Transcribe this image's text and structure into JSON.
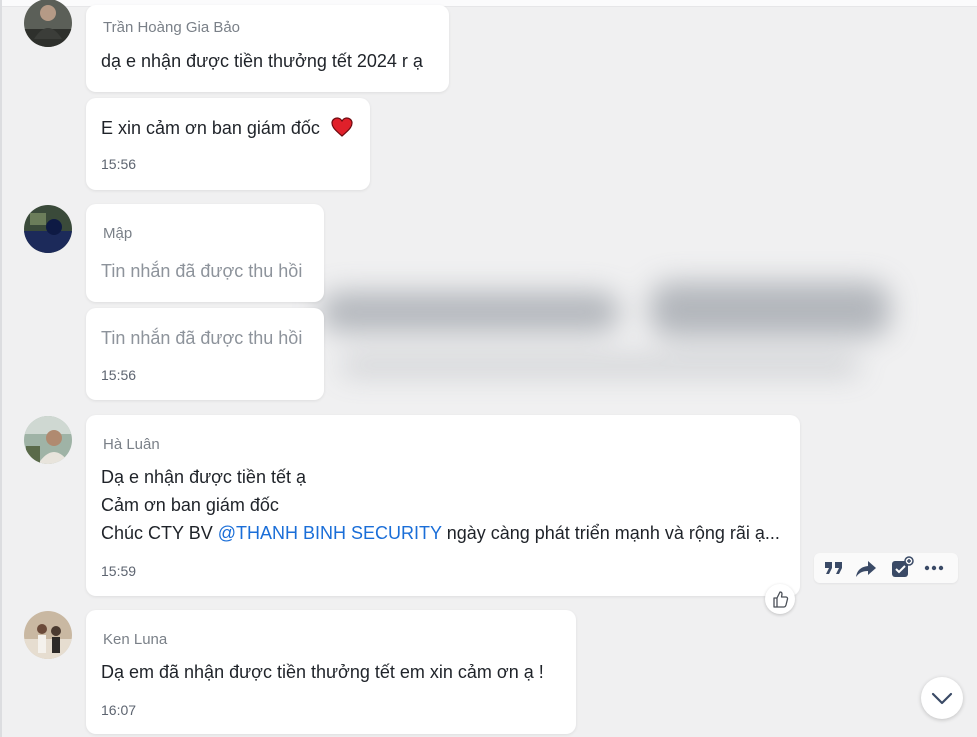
{
  "messages": [
    {
      "sender": "Trần Hoàng Gia Bảo",
      "bubbles": [
        {
          "lines": [
            "dạ e nhận được tiền thưởng tết 2024 r ạ"
          ]
        },
        {
          "lines": [
            "E xin cảm ơn ban giám đốc"
          ],
          "emoji": "red-heart",
          "time": "15:56"
        }
      ]
    },
    {
      "sender": "Mập",
      "bubbles": [
        {
          "lines": [
            "Tin nhắn đã được thu hồi"
          ]
        },
        {
          "lines": [
            "Tin nhắn đã được thu hồi"
          ],
          "time": "15:56"
        }
      ]
    },
    {
      "sender": "Hà Luân",
      "bubbles": [
        {
          "lines": [
            "Dạ e nhận được tiền tết ạ",
            "Cảm ơn ban giám đốc"
          ],
          "line3_prefix": "Chúc CTY BV ",
          "line3_mention": "@THANH BINH SECURITY",
          "line3_suffix": " ngày càng phát triển mạnh và rộng rãi ạ...",
          "time": "15:59"
        }
      ]
    },
    {
      "sender": "Ken Luna",
      "bubbles": [
        {
          "lines": [
            "Dạ em đã nhận được tiền thưởng tết em xin cảm ơn ạ !"
          ],
          "time": "16:07"
        }
      ]
    }
  ],
  "message_actions": [
    "quote-icon",
    "forward-icon",
    "add-task-icon",
    "more-icon"
  ],
  "reaction": "thumbs-up-icon",
  "scroll": "chevron-down-icon",
  "colors": {
    "mention": "#1a6ed8",
    "background": "#f0f0f1",
    "bubble": "#ffffff",
    "heart": "#e0202a"
  }
}
